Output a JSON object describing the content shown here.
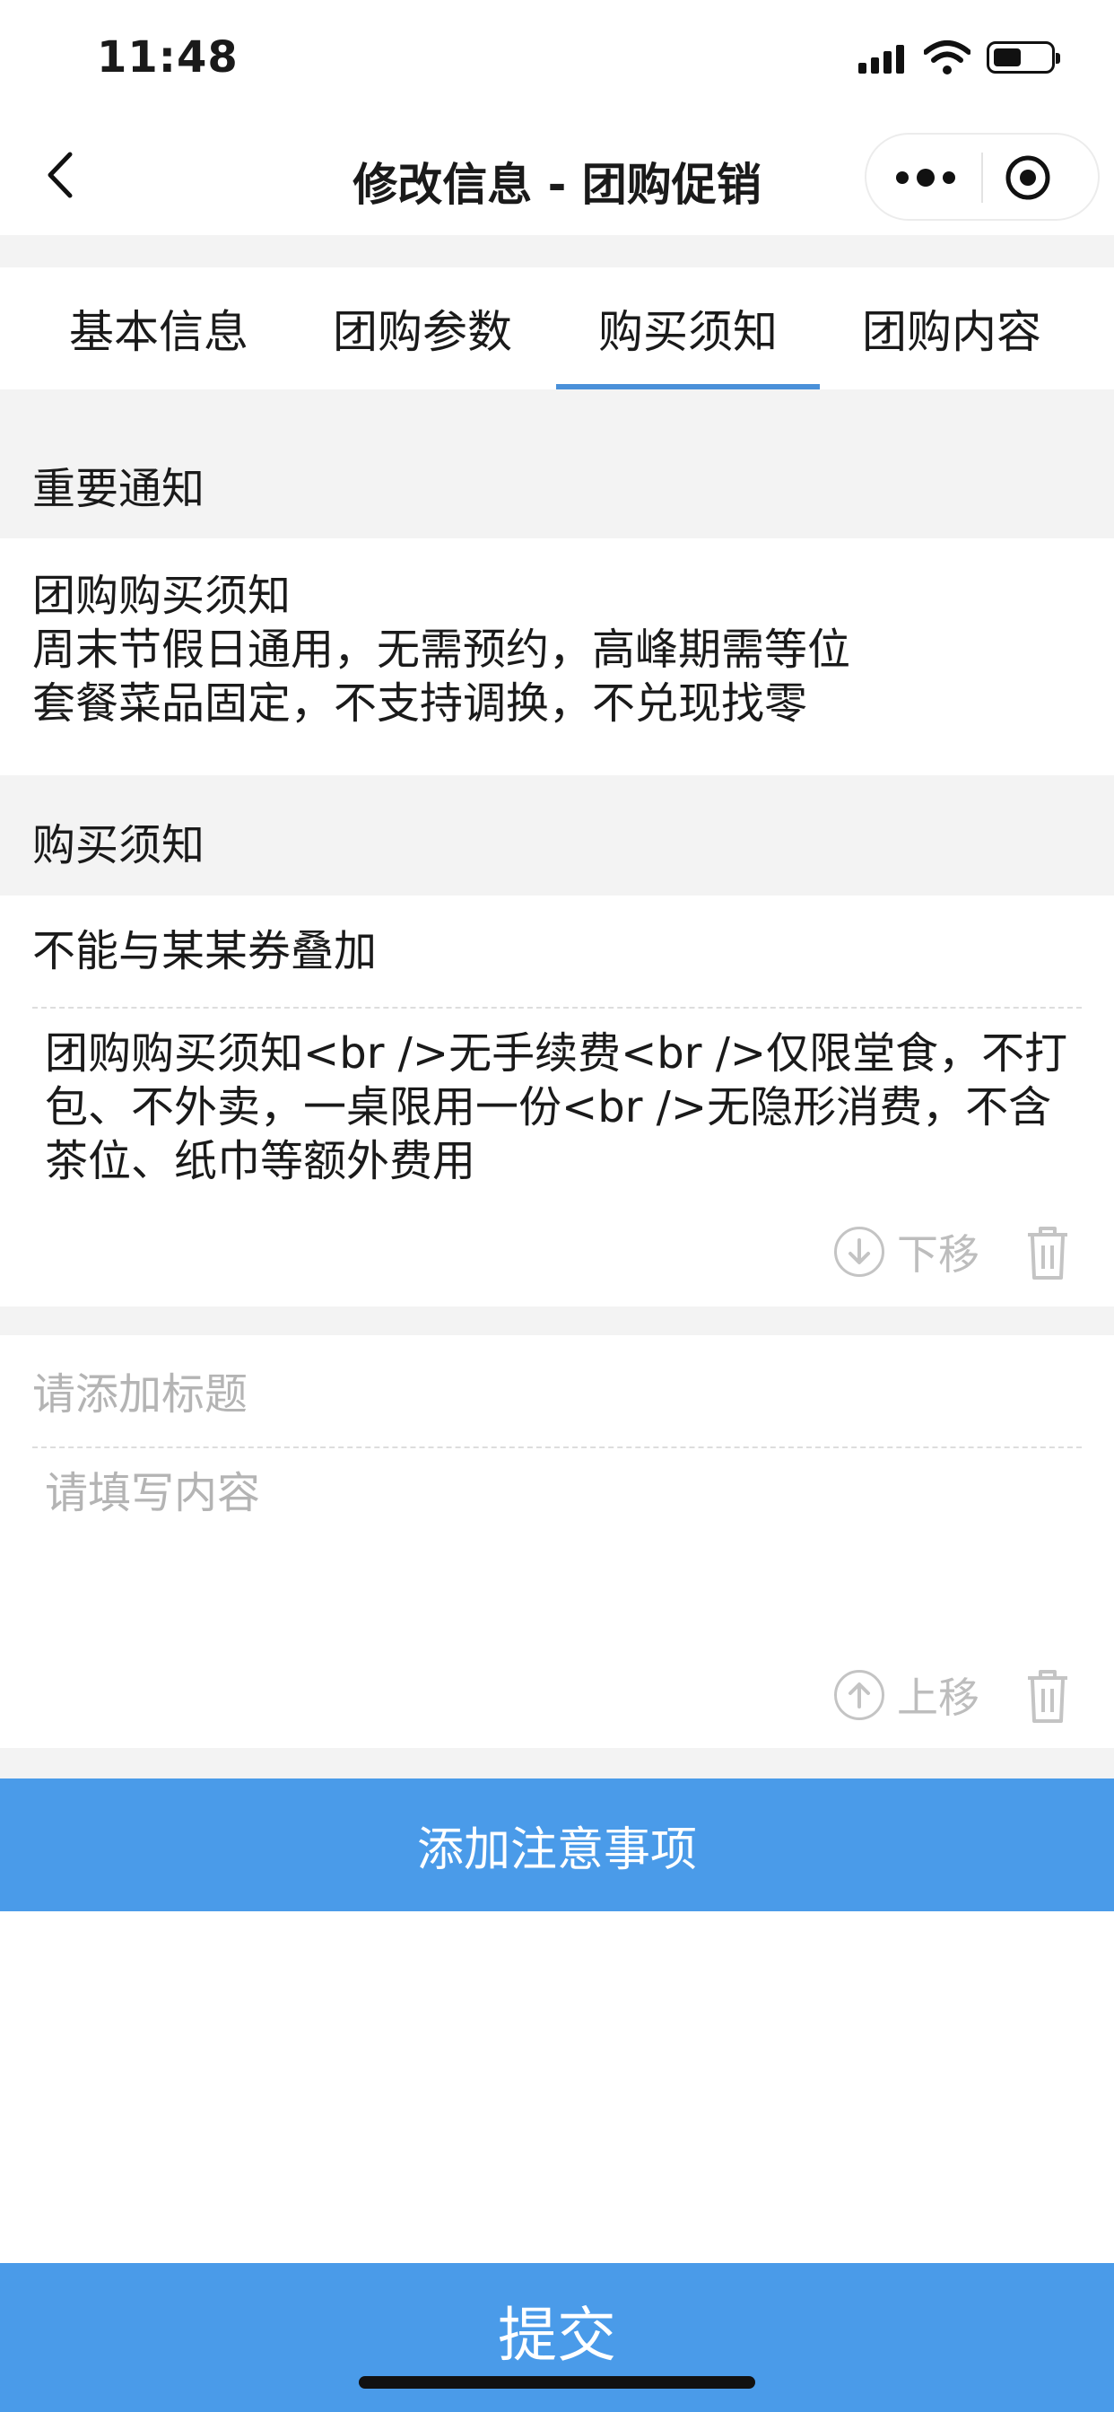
{
  "status_bar": {
    "time": "11:48"
  },
  "nav": {
    "title": "修改信息 - 团购促销"
  },
  "tabs": [
    {
      "label": "基本信息",
      "active": false
    },
    {
      "label": "团购参数",
      "active": false
    },
    {
      "label": "购买须知",
      "active": true
    },
    {
      "label": "团购内容",
      "active": false
    }
  ],
  "important_notice": {
    "heading": "重要通知",
    "lines": [
      "团购购买须知",
      "周末节假日通用，无需预约，高峰期需等位",
      "套餐菜品固定，不支持调换，不兑现找零"
    ]
  },
  "purchase_notes": {
    "heading": "购买须知",
    "items": [
      {
        "title": "不能与某某券叠加",
        "content": "团购购买须知<br />无手续费<br />仅限堂食，不打包、不外卖，一桌限用一份<br />无隐形消费，不含茶位、纸巾等额外费用",
        "move_label": "下移"
      },
      {
        "title_placeholder": "请添加标题",
        "content_placeholder": "请填写内容",
        "move_label": "上移"
      }
    ]
  },
  "add_button": {
    "label": "添加注意事项"
  },
  "submit_button": {
    "label": "提交"
  },
  "colors": {
    "accent": "#4a9be9",
    "tab_indicator": "#4a90d9",
    "section_bg": "#f3f3f3",
    "placeholder": "#b4b4b4"
  }
}
